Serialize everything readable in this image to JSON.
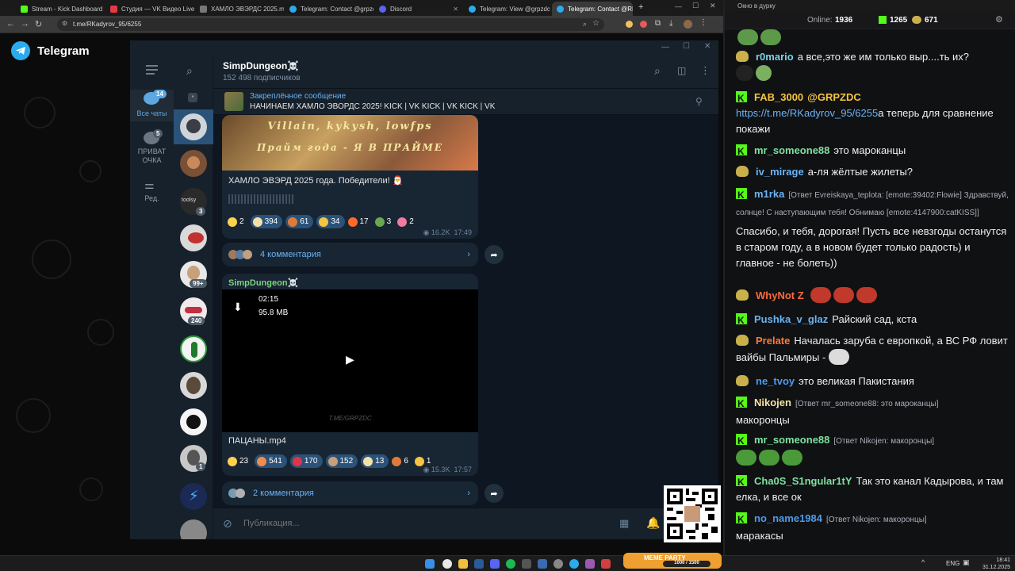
{
  "browser": {
    "tabs": [
      {
        "label": "Stream - Kick Dashboard",
        "color": "#53fc18"
      },
      {
        "label": "Студия — VK Видео Live",
        "color": "#e63946"
      },
      {
        "label": "ХАМЛО ЭВЭРДС 2025.mp4",
        "color": "#777777"
      },
      {
        "label": "Telegram: Contact @grpzdc",
        "color": "#2aabee"
      },
      {
        "label": "Discord",
        "color": "#5865f2"
      },
      {
        "label": "Telegram: View @grpzdc",
        "color": "#2aabee"
      },
      {
        "label": "Telegram: Contact @RKady…",
        "color": "#2aabee"
      }
    ],
    "url": "t.me/RKadyrov_95/6255"
  },
  "tg_site": {
    "brand": "Telegram"
  },
  "telegram": {
    "rail": {
      "all_chats": "Все чаты",
      "all_chats_badge": "14",
      "private": "ПРИВАТ ОЧКА",
      "private_badge": "5",
      "edit": "Ред."
    },
    "chatlist_badges": {
      "b1": "3",
      "b2": "99+",
      "b3": "240",
      "b4": "1"
    },
    "channel": {
      "name": "SimpDungeon☠️",
      "subscribers": "152 498 подписчиков"
    },
    "pinned": {
      "title": "Закреплённое сообщение",
      "text": "НАЧИНАЕМ ХАМЛО ЭВОРДС 2025!  KICK | VK KICK | VK KICK | VK"
    },
    "post1": {
      "banner_line1": "Villain, kykysh, lowfps",
      "banner_line2": "Прайм года - Я В ПРАЙМЕ",
      "caption": "ХАМЛО ЭВЭРД 2025 года. Победители! 🎅",
      "reactions": [
        {
          "count": "2",
          "color": "#ffd24d",
          "plain": true
        },
        {
          "count": "394",
          "color": "#f4e0a8"
        },
        {
          "count": "61",
          "color": "#e07a3b"
        },
        {
          "count": "34",
          "color": "#f5c542"
        },
        {
          "count": "17",
          "color": "#ff6a2b",
          "plain": true
        },
        {
          "count": "3",
          "color": "#6aa84f",
          "plain": true
        },
        {
          "count": "2",
          "color": "#f07aa0",
          "plain": true
        }
      ],
      "views": "16.2K",
      "time": "17:49",
      "comments": "4 комментария"
    },
    "post2": {
      "author": "SimpDungeon☠️",
      "duration": "02:15",
      "size": "95.8 MB",
      "watermark": "T.ME/GRPZDC",
      "filename": "ПАЦАНЫ.mp4",
      "reactions": [
        {
          "count": "23",
          "color": "#ffd24d",
          "plain": true
        },
        {
          "count": "541",
          "color": "#f08c4a"
        },
        {
          "count": "170",
          "color": "#e0344a"
        },
        {
          "count": "152",
          "color": "#c7a07a"
        },
        {
          "count": "13",
          "color": "#f4e0a8"
        },
        {
          "count": "6",
          "color": "#e07a3b",
          "plain": true
        },
        {
          "count": "1",
          "color": "#f5c542",
          "plain": true
        }
      ],
      "views": "15.3K",
      "time": "17:57",
      "comments": "2 комментария"
    },
    "composer": {
      "placeholder": "Публикация..."
    }
  },
  "chat": {
    "window_title": "Окно в дурку",
    "online_label": "Online:",
    "online_count": "1936",
    "kick_count": "1265",
    "frog_count": "671",
    "messages": [
      {
        "user": "r0mario",
        "color": "#7ad3e8",
        "badge": "frog",
        "text": "а все,это же им только выр....ть их?"
      },
      {
        "user": "FAB_3000",
        "color": "#f5c542",
        "badge": "kick",
        "mention": "@GRPZDC",
        "link": "https://t.me/RKadyrov_95/6255",
        "text": "а теперь для сравнение покажи"
      },
      {
        "user": "mr_someone88",
        "color": "#7fe0a0",
        "badge": "kick",
        "text": "это мароканцы"
      },
      {
        "user": "iv_mirage",
        "color": "#6ab3f3",
        "badge": "frog",
        "text": "а-ля жёлтые жилеты?"
      },
      {
        "user": "m1rka",
        "color": "#6ab3f3",
        "badge": "kick",
        "reply": "[Ответ Evreiskaya_teplota: [emote:39402:Flowie] Здравствуй, солнце! С наступающим тебя! Обнимаю [emote:4147900:catKISS]]",
        "text": "Спасибо, и тебя, дорогая! Пусть все невзгоды останутся в старом году, а в новом будет только радость) и главное - не болеть))"
      },
      {
        "user": "WhyNot Z",
        "color": "#ff6a3d",
        "badge": "frog",
        "text": ""
      },
      {
        "user": "Pushka_v_glaz",
        "color": "#6ab3f3",
        "badge": "kick",
        "text": "Райский сад, кста"
      },
      {
        "user": "Prelate",
        "color": "#ff7a3d",
        "badge": "frog",
        "text": "Началась заруба с европкой, а ВС РФ ловит вайбы Пальмиры -"
      },
      {
        "user": "ne_tvoy",
        "color": "#4d9bea",
        "badge": "frog",
        "text": "это великая Пакистания"
      },
      {
        "user": "Nikojen",
        "color": "#f5e3a0",
        "badge": "kick",
        "reply": "[Ответ mr_someone88: это мароканцы]",
        "text": "макоронцы"
      },
      {
        "user": "mr_someone88",
        "color": "#7fe0a0",
        "badge": "kick",
        "reply": "[Ответ Nikojen: макоронцы]",
        "text": ""
      },
      {
        "user": "Cha0S_S1ngular1tY",
        "color": "#7fe0a0",
        "badge": "kick",
        "text": "Так это канал Кадырова, и там елка, и все ок"
      },
      {
        "user": "no_name1984",
        "color": "#4d9bea",
        "badge": "kick",
        "reply": "[Ответ Nikojen: макоронцы]",
        "text": "маракасы"
      }
    ]
  },
  "taskbar": {
    "lang": "ENG",
    "time": "18:41",
    "date": "31.12.2025",
    "tray_label": "MEME PARTY",
    "tray_counter": "1000 / 1500"
  }
}
